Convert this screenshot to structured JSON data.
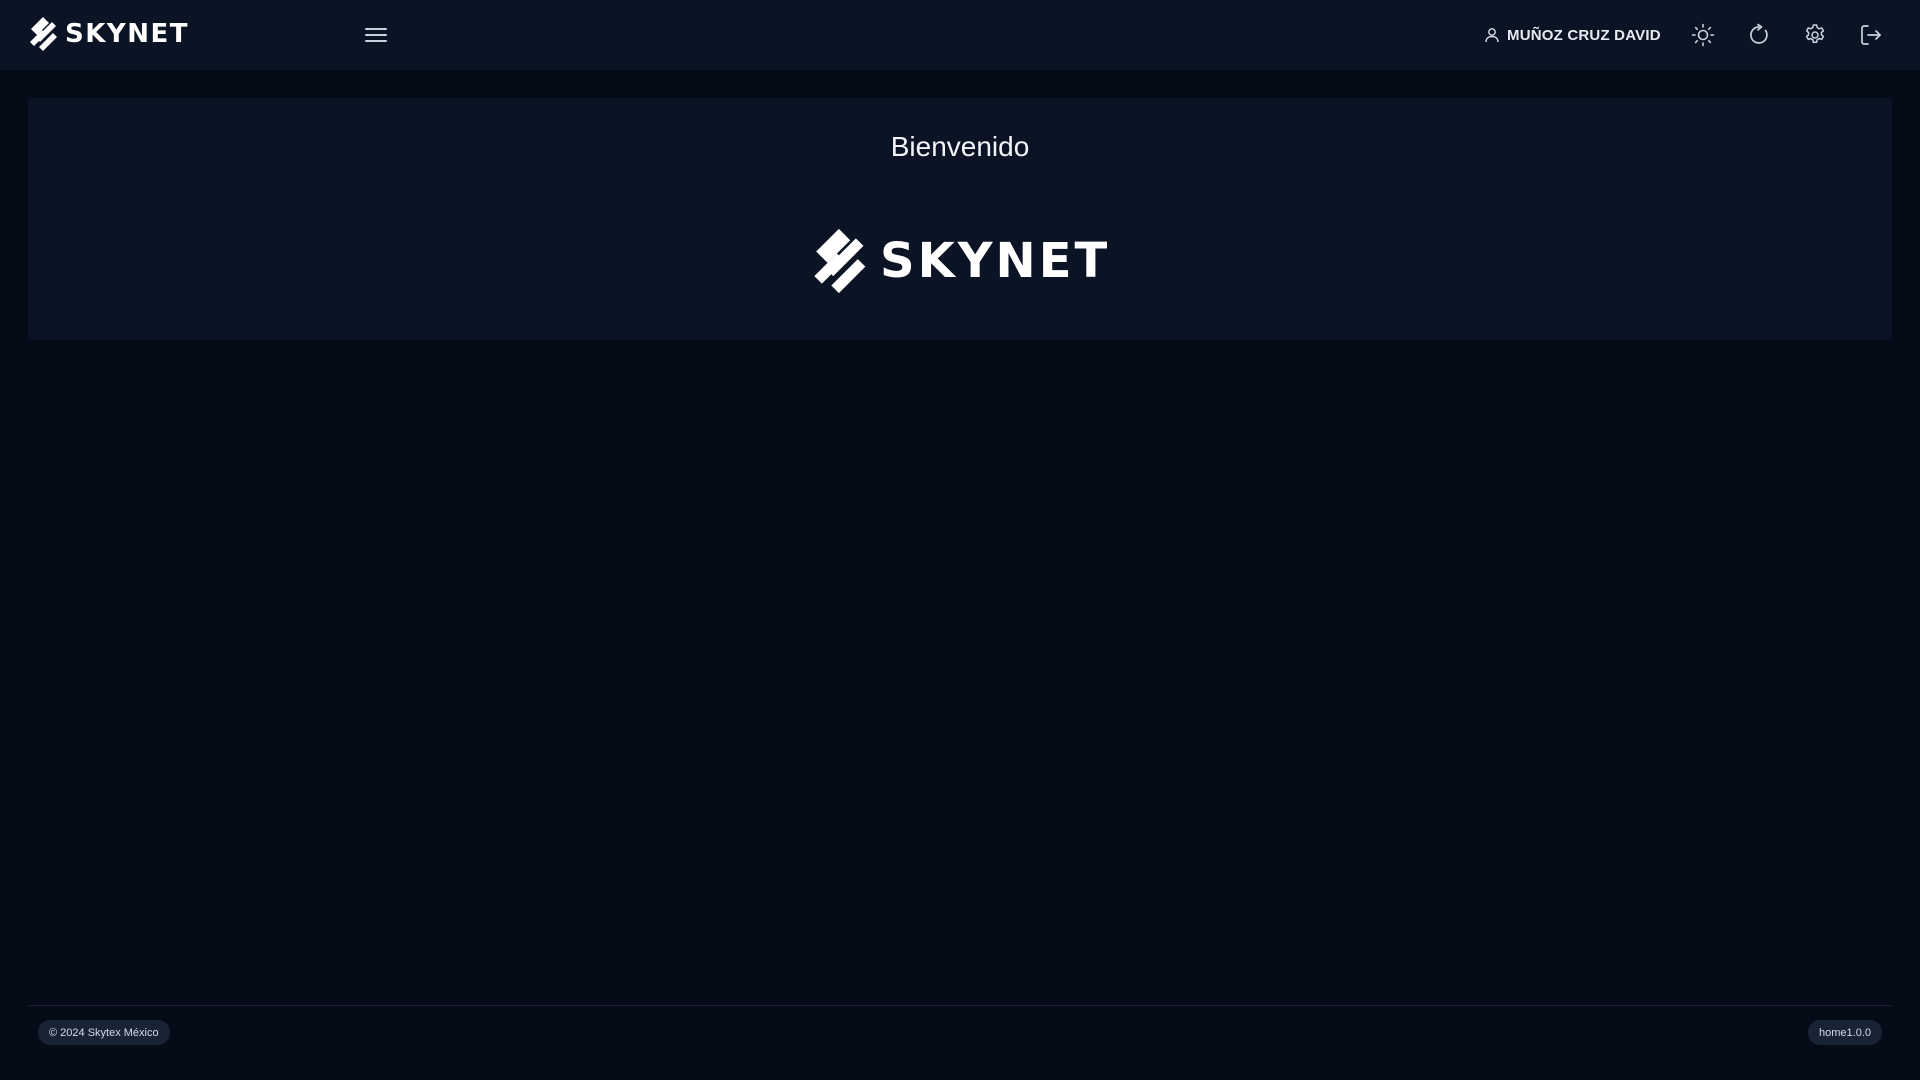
{
  "header": {
    "brand_name": "SKYNET",
    "menu_icon": "hamburger-menu-icon",
    "user": {
      "icon": "user-icon",
      "name": "MUÑOZ CRUZ DAVID"
    },
    "actions": [
      {
        "name": "theme-toggle",
        "icon": "sun-icon"
      },
      {
        "name": "refresh",
        "icon": "refresh-icon"
      },
      {
        "name": "settings",
        "icon": "gear-icon"
      },
      {
        "name": "logout",
        "icon": "logout-icon"
      }
    ]
  },
  "main": {
    "welcome_title": "Bienvenido",
    "logo_text": "SKYNET"
  },
  "footer": {
    "copyright": "© 2024 Skytex México",
    "version": "home1.0.0"
  },
  "colors": {
    "background": "#060c17",
    "panel": "#0b1424",
    "pill": "#182336",
    "text": "#e6ebf2"
  }
}
